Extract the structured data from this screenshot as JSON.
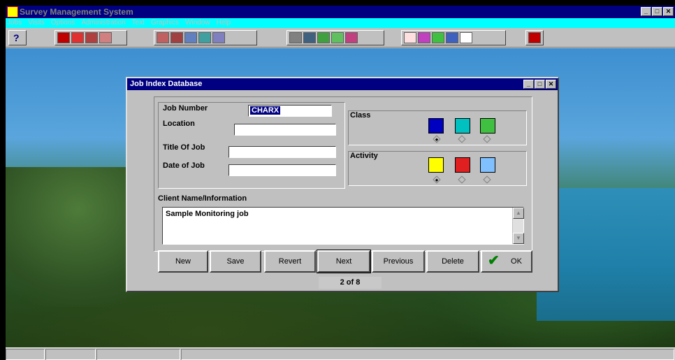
{
  "app": {
    "title": "Survey Management System",
    "window_controls": [
      "_",
      "□",
      "✕"
    ]
  },
  "menu": [
    "Jobs",
    "Visits",
    "Options",
    "Administration",
    "Text",
    "Graphics",
    "Window",
    "Help"
  ],
  "toolbar": {
    "help_label": "?"
  },
  "dialog": {
    "title": "Job Index Database",
    "fields": {
      "job_number_label": "Job Number",
      "job_number_value": "CHARX",
      "location_label": "Location",
      "location_value": "",
      "title_label": "Title Of Job",
      "title_value": "",
      "date_label": "Date of Job",
      "date_value": ""
    },
    "class_label": "Class",
    "activity_label": "Activity",
    "client_label": "Client Name/Information",
    "client_value": "Sample Monitoring job",
    "buttons": {
      "new": "New",
      "save": "Save",
      "revert": "Revert",
      "next": "Next",
      "previous": "Previous",
      "delete": "Delete",
      "ok": "OK"
    },
    "record_indicator": "2 of 8"
  },
  "colors": {
    "title_bar": "#000080",
    "menu_bar": "#00ffff",
    "face": "#c0c0c0"
  }
}
